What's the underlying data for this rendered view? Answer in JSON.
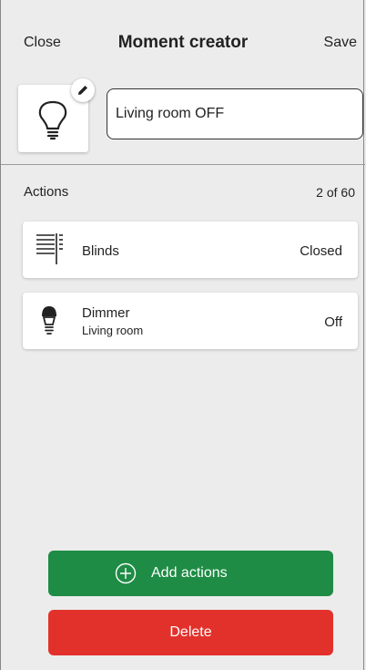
{
  "header": {
    "close_label": "Close",
    "title": "Moment creator",
    "save_label": "Save"
  },
  "moment": {
    "icon": "lightbulb-icon",
    "name": "Living room OFF"
  },
  "actions": {
    "label": "Actions",
    "count": "2 of 60",
    "items": [
      {
        "icon": "blinds-icon",
        "title": "Blinds",
        "value": "Closed"
      },
      {
        "icon": "bulb-icon",
        "title": "Dimmer",
        "subtitle": "Living room",
        "value": "Off"
      }
    ]
  },
  "buttons": {
    "add_label": "Add actions",
    "delete_label": "Delete"
  },
  "colors": {
    "add": "#1e8c45",
    "delete": "#e2312b"
  }
}
